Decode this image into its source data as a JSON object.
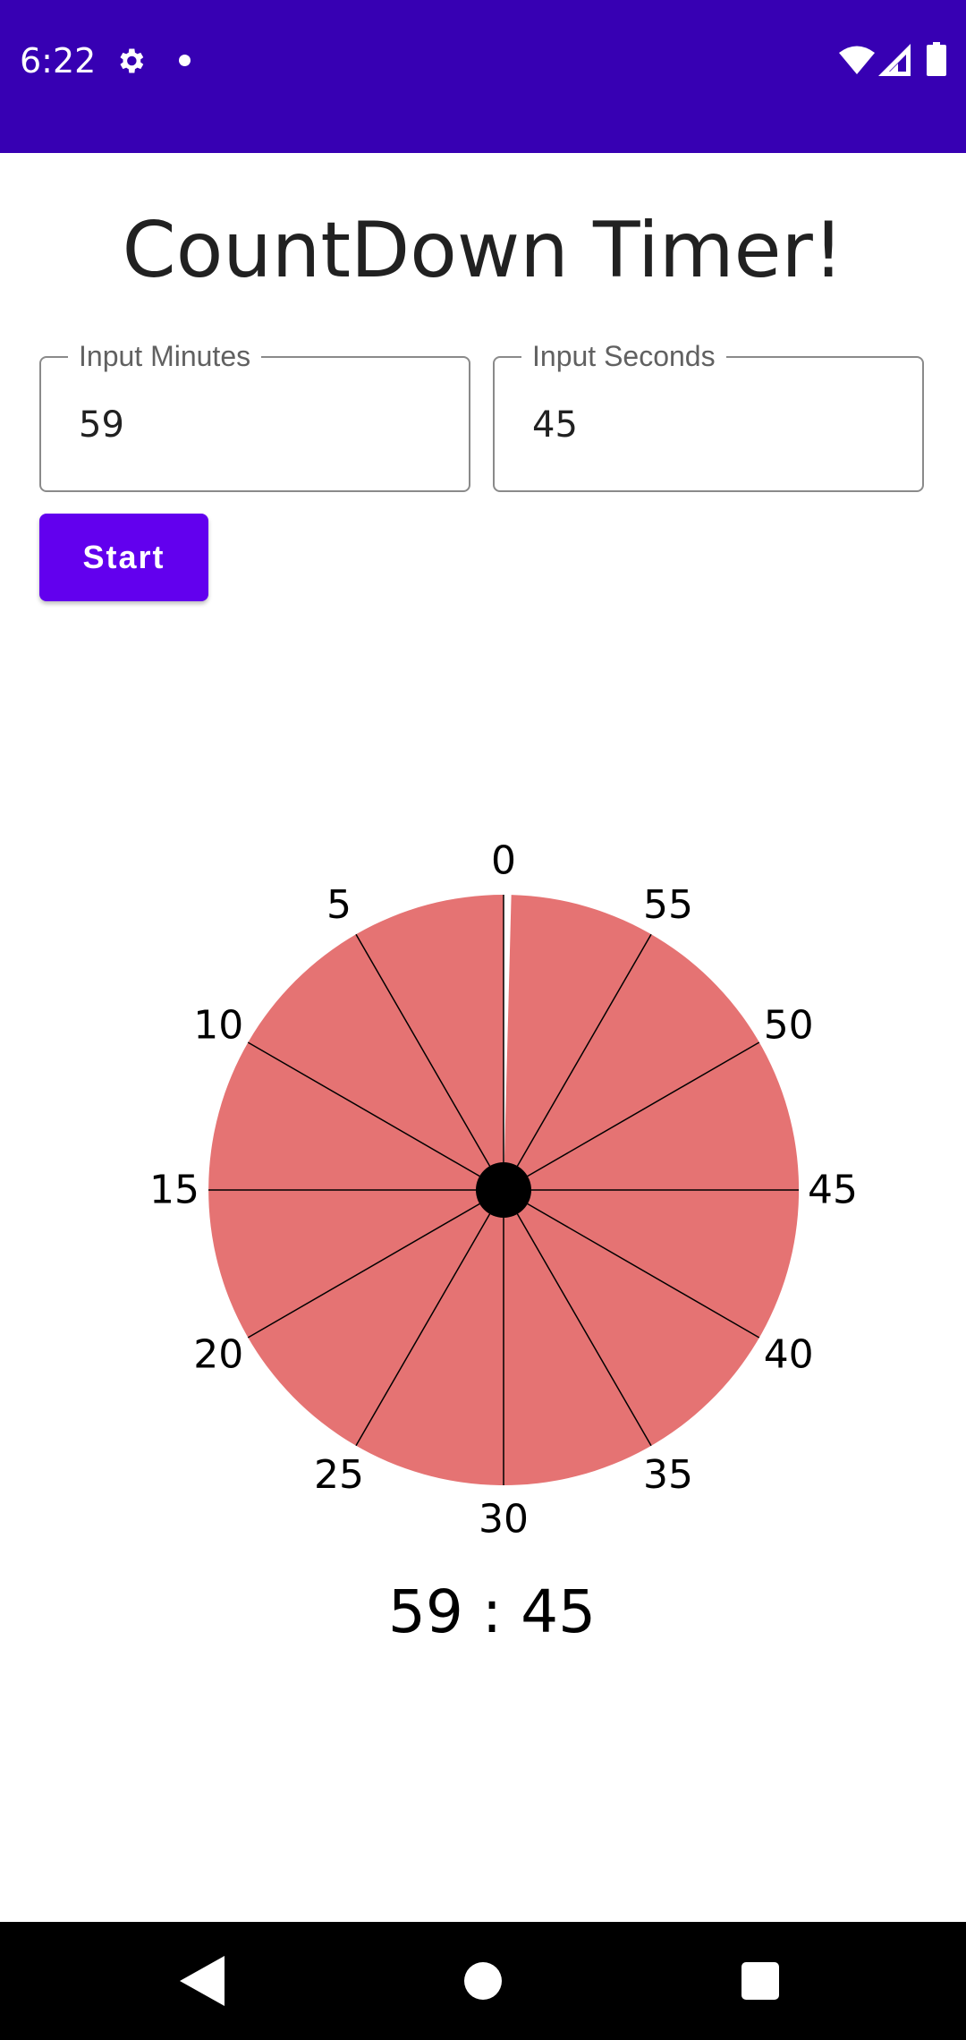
{
  "status_bar": {
    "time": "6:22",
    "icons": [
      "gear-icon",
      "notification-dot-icon",
      "wifi-icon",
      "signal-icon",
      "battery-icon"
    ],
    "background": "#3700b3"
  },
  "title": "CountDown Timer!",
  "minutes_field": {
    "label": "Input Minutes",
    "value": "59"
  },
  "seconds_field": {
    "label": "Input Seconds",
    "value": "45"
  },
  "start_button": {
    "label": "Start",
    "color": "#6200ee"
  },
  "dial": {
    "colors": {
      "fill": "#e57373",
      "lines": "#000000",
      "center": "#000000"
    },
    "total_minutes": 60,
    "remaining_minutes": 59.75,
    "labels": [
      "0",
      "55",
      "50",
      "45",
      "40",
      "35",
      "30",
      "25",
      "20",
      "15",
      "10",
      "5"
    ]
  },
  "readout": "59 : 45",
  "nav_bar": {
    "icons": [
      "back-icon",
      "home-icon",
      "recents-icon"
    ]
  }
}
